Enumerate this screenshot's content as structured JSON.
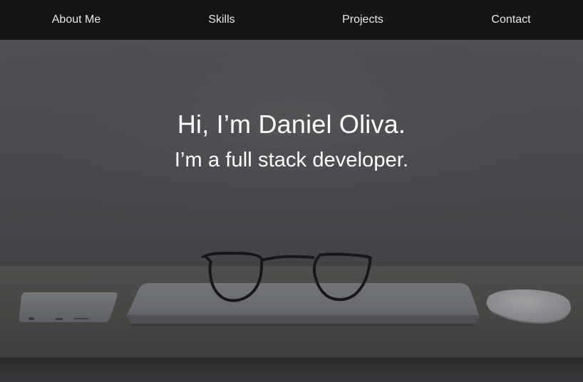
{
  "nav": {
    "items": [
      {
        "label": "About Me"
      },
      {
        "label": "Skills"
      },
      {
        "label": "Projects"
      },
      {
        "label": "Contact"
      }
    ]
  },
  "hero": {
    "title": "Hi, I’m Daniel Oliva.",
    "subtitle": "I’m a full stack developer.",
    "background": "desk-with-laptop-glasses-phone-mouse-photo"
  },
  "colors": {
    "navbar_bg": "#141515",
    "nav_text": "#e8e8e8",
    "hero_text": "#ffffff"
  }
}
